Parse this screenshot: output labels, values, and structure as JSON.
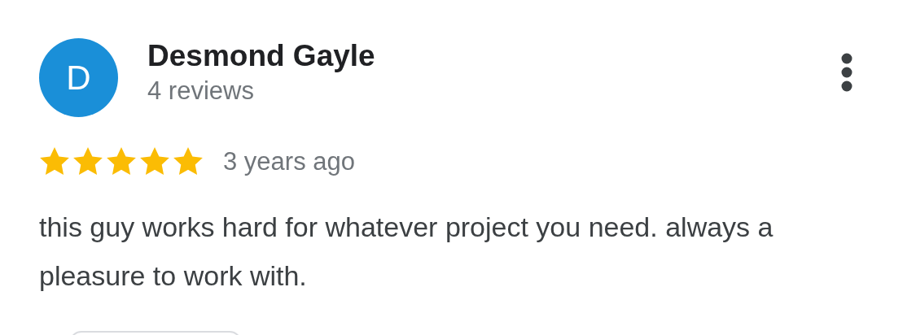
{
  "review": {
    "avatar_letter": "D",
    "author": "Desmond Gayle",
    "review_count": "4 reviews",
    "stars": 5,
    "time": "3 years ago",
    "text": "this guy works hard for whatever project you need. always a pleasure to work with."
  }
}
